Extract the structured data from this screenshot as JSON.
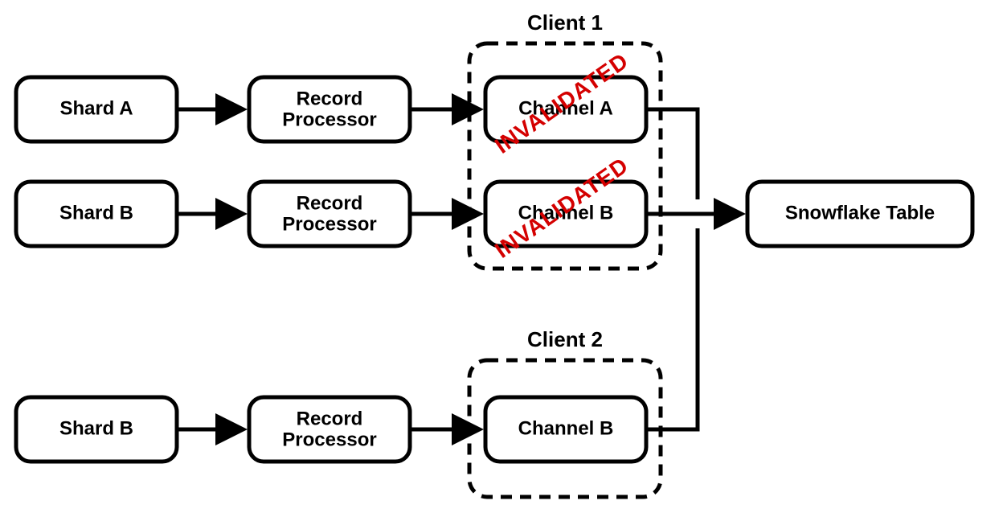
{
  "titles": {
    "client1": "Client 1",
    "client2": "Client 2"
  },
  "boxes": {
    "shardA": "Shard A",
    "shardB1": "Shard B",
    "shardB2": "Shard B",
    "rpA": "Record",
    "rpA2": "Processor",
    "rpB": "Record",
    "rpB2": "Processor",
    "rpC": "Record",
    "rpC2": "Processor",
    "chA": "Channel A",
    "chB1": "Channel B",
    "chB2": "Channel B",
    "snow": "Snowflake Table"
  },
  "stamps": {
    "inval1": "INVALIDATED",
    "inval2": "INVALIDATED"
  }
}
